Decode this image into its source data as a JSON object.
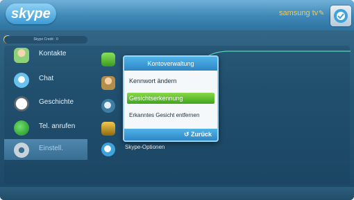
{
  "header": {
    "logo": "skype",
    "tv_name": "samsung tv",
    "tv_icon": "pen-icon"
  },
  "credit": {
    "text": "Skype Credit : 0"
  },
  "sidebar": {
    "items": [
      {
        "label": "Kontakte",
        "icon": "contacts-icon",
        "color": "#8fd07a"
      },
      {
        "label": "Chat",
        "icon": "chat-icon",
        "color": "#69c1f0"
      },
      {
        "label": "Geschichte",
        "icon": "history-clock-icon",
        "color": "#e2e6ea"
      },
      {
        "label": "Tel. anrufen",
        "icon": "phone-icon",
        "color": "#3fb43b"
      },
      {
        "label": "Einstell.",
        "icon": "settings-gear-icon",
        "color": "#c8d3db",
        "active": true
      }
    ]
  },
  "settings_list": {
    "icons": [
      "status-check-icon",
      "profile-icon",
      "audio-video-icon",
      "privacy-lock-icon",
      "skype-options-icon"
    ],
    "skype_options_label": "Skype-Optionen"
  },
  "dialog": {
    "title": "Kontoverwaltung",
    "items": [
      "Kennwort ändern",
      "Gesichtserkennung",
      "Erkanntes Gesicht entfernen"
    ],
    "selected_index": 1,
    "back_label": "Zurück",
    "back_icon": "return-arrow-icon"
  },
  "colors": {
    "accent": "#2f86c6",
    "selected": "#5bbf2a",
    "highlight": "#7ed957"
  }
}
